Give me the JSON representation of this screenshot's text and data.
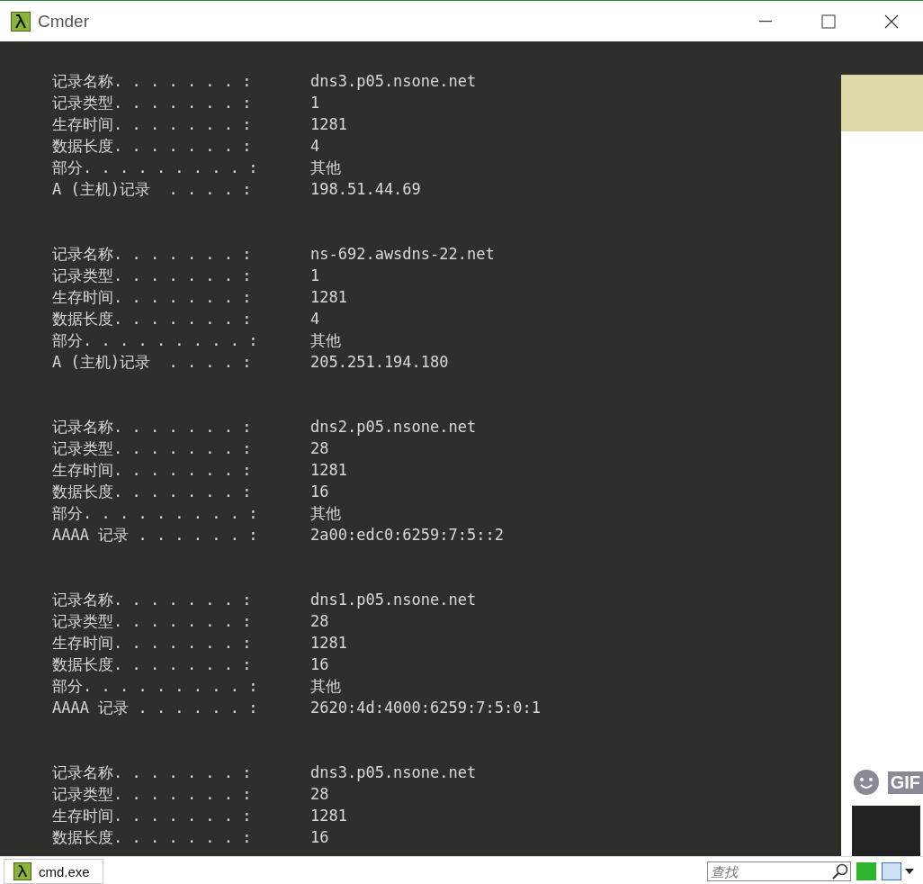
{
  "window": {
    "title": "Cmder"
  },
  "records": [
    {
      "lines": [
        {
          "label": "记录名称. . . . . . . :",
          "value": "dns3.p05.nsone.net"
        },
        {
          "label": "记录类型. . . . . . . :",
          "value": "1"
        },
        {
          "label": "生存时间. . . . . . . :",
          "value": "1281"
        },
        {
          "label": "数据长度. . . . . . . :",
          "value": "4"
        },
        {
          "label": "部分. . . . . . . . . :",
          "value": "其他"
        },
        {
          "label": "A (主机)记录  . . . . :",
          "value": "198.51.44.69"
        }
      ]
    },
    {
      "lines": [
        {
          "label": "记录名称. . . . . . . :",
          "value": "ns-692.awsdns-22.net"
        },
        {
          "label": "记录类型. . . . . . . :",
          "value": "1"
        },
        {
          "label": "生存时间. . . . . . . :",
          "value": "1281"
        },
        {
          "label": "数据长度. . . . . . . :",
          "value": "4"
        },
        {
          "label": "部分. . . . . . . . . :",
          "value": "其他"
        },
        {
          "label": "A (主机)记录  . . . . :",
          "value": "205.251.194.180"
        }
      ]
    },
    {
      "lines": [
        {
          "label": "记录名称. . . . . . . :",
          "value": "dns2.p05.nsone.net"
        },
        {
          "label": "记录类型. . . . . . . :",
          "value": "28"
        },
        {
          "label": "生存时间. . . . . . . :",
          "value": "1281"
        },
        {
          "label": "数据长度. . . . . . . :",
          "value": "16"
        },
        {
          "label": "部分. . . . . . . . . :",
          "value": "其他"
        },
        {
          "label": "AAAA 记录 . . . . . . :",
          "value": "2a00:edc0:6259:7:5::2"
        }
      ]
    },
    {
      "lines": [
        {
          "label": "记录名称. . . . . . . :",
          "value": "dns1.p05.nsone.net"
        },
        {
          "label": "记录类型. . . . . . . :",
          "value": "28"
        },
        {
          "label": "生存时间. . . . . . . :",
          "value": "1281"
        },
        {
          "label": "数据长度. . . . . . . :",
          "value": "16"
        },
        {
          "label": "部分. . . . . . . . . :",
          "value": "其他"
        },
        {
          "label": "AAAA 记录 . . . . . . :",
          "value": "2620:4d:4000:6259:7:5:0:1"
        }
      ]
    },
    {
      "lines": [
        {
          "label": "记录名称. . . . . . . :",
          "value": "dns3.p05.nsone.net"
        },
        {
          "label": "记录类型. . . . . . . :",
          "value": "28"
        },
        {
          "label": "生存时间. . . . . . . :",
          "value": "1281"
        },
        {
          "label": "数据长度. . . . . . . :",
          "value": "16"
        }
      ]
    }
  ],
  "side_panel": {
    "gif_label": "GIF"
  },
  "status_bar": {
    "tab": "cmd.exe",
    "search": {
      "placeholder": "查找"
    }
  }
}
